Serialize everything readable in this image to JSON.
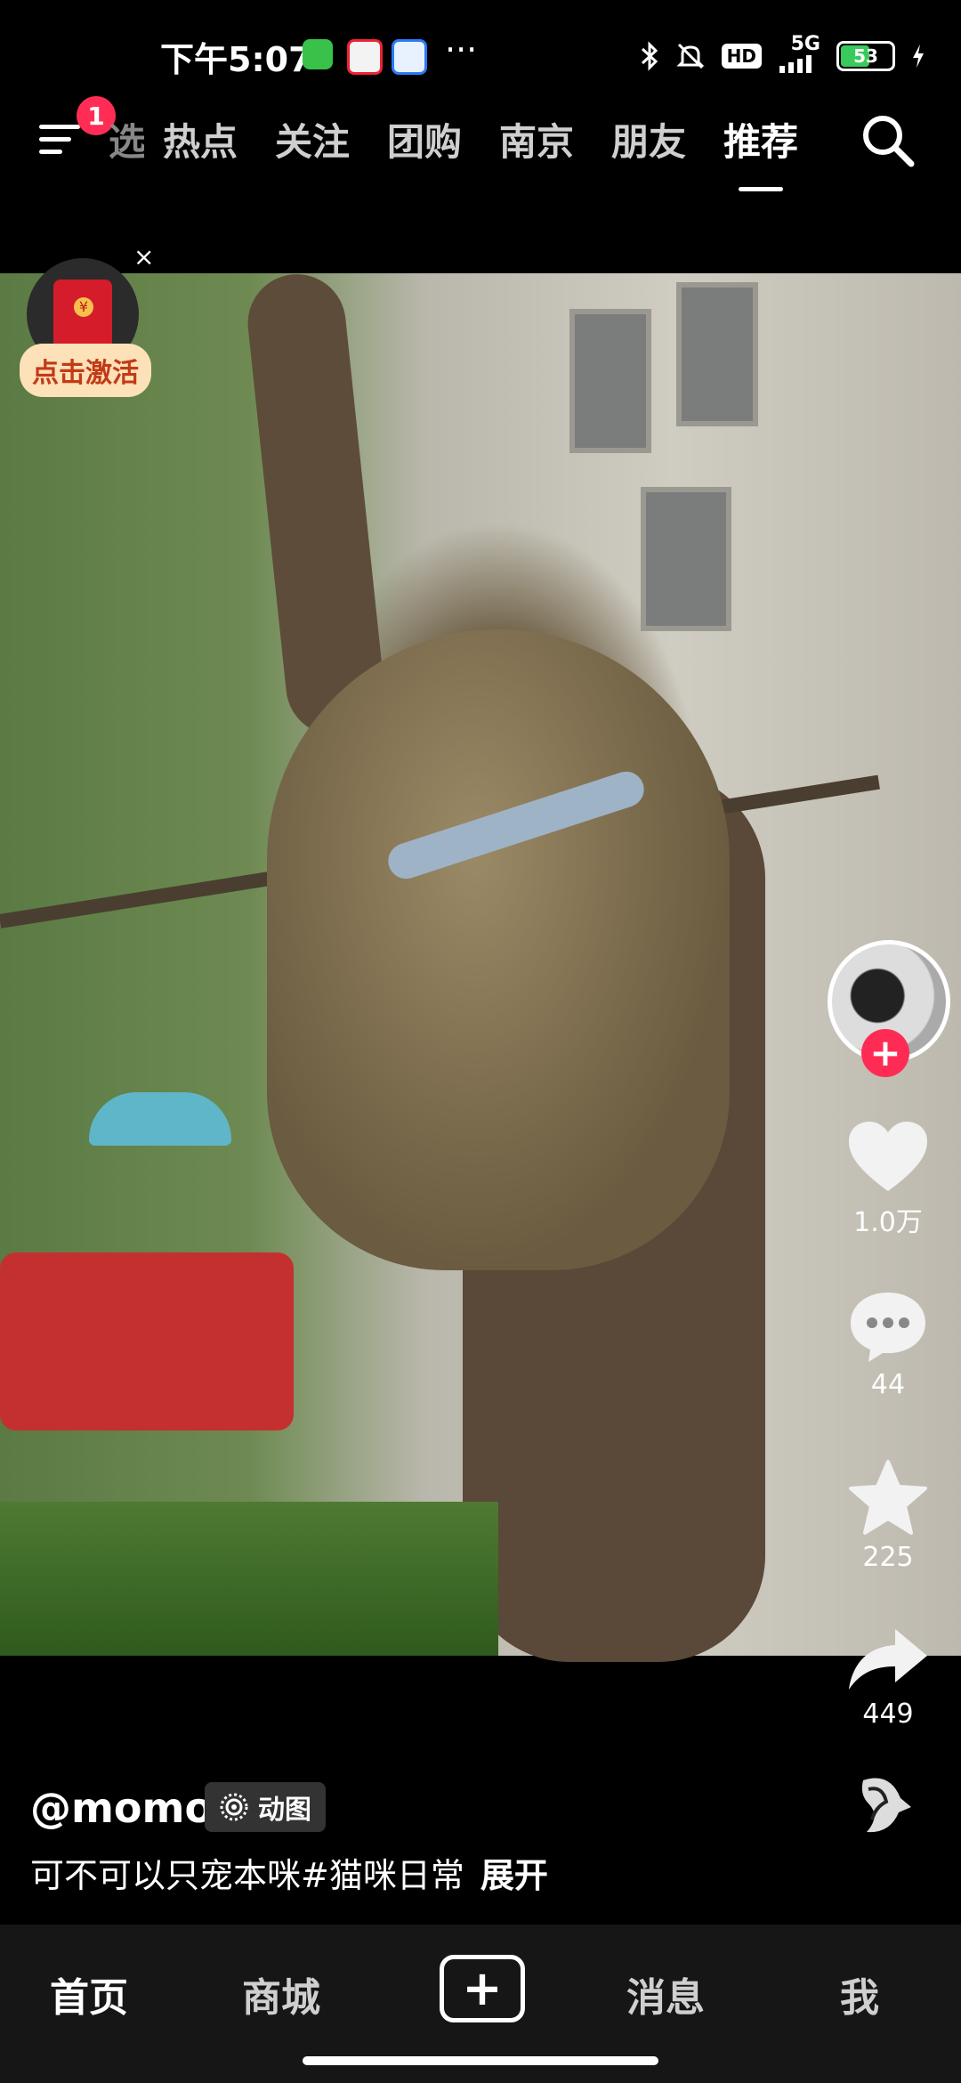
{
  "status_bar": {
    "time": "下午5:07",
    "more": "···",
    "network": "5G",
    "hd": "HD",
    "battery": "53",
    "battery_level": 0.53
  },
  "top_nav": {
    "notification_count": "1",
    "partial_tab": "选",
    "tabs": [
      "热点",
      "关注",
      "团购",
      "南京",
      "朋友",
      "推荐"
    ],
    "active_tab": "推荐"
  },
  "red_packet": {
    "close": "×",
    "label": "点击激活"
  },
  "actions": {
    "follow": "+",
    "likes": "1.0万",
    "comments": "44",
    "favorites": "225",
    "shares": "449"
  },
  "post": {
    "author": "@momo",
    "badge": "动图",
    "caption": "可不可以只宠本咪#猫咪日常",
    "expand": "展开"
  },
  "bottom_nav": {
    "home": "首页",
    "mall": "商城",
    "create": "+",
    "messages": "消息",
    "me": "我"
  },
  "colors": {
    "accent": "#fe2c55",
    "battery_green": "#3ac95c",
    "red_packet": "#d51c2a",
    "red_packet_label_bg": "#fde1b8"
  }
}
